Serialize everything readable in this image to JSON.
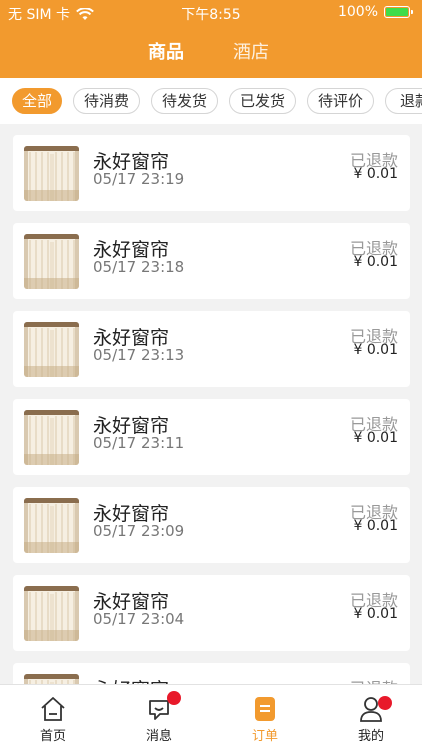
{
  "status_bar": {
    "carrier": "无 SIM 卡",
    "time": "下午8:55",
    "battery": "100%"
  },
  "top_tabs": [
    {
      "label": "商品",
      "active": true
    },
    {
      "label": "酒店",
      "active": false
    }
  ],
  "filters": [
    {
      "label": "全部",
      "active": true
    },
    {
      "label": "待消费",
      "active": false
    },
    {
      "label": "待发货",
      "active": false
    },
    {
      "label": "已发货",
      "active": false
    },
    {
      "label": "待评价",
      "active": false
    },
    {
      "label": "退款",
      "active": false
    }
  ],
  "orders": [
    {
      "title": "永好窗帘",
      "time": "05/17 23:19",
      "status": "已退款",
      "price": "¥ 0.01"
    },
    {
      "title": "永好窗帘",
      "time": "05/17 23:18",
      "status": "已退款",
      "price": "¥ 0.01"
    },
    {
      "title": "永好窗帘",
      "time": "05/17 23:13",
      "status": "已退款",
      "price": "¥ 0.01"
    },
    {
      "title": "永好窗帘",
      "time": "05/17 23:11",
      "status": "已退款",
      "price": "¥ 0.01"
    },
    {
      "title": "永好窗帘",
      "time": "05/17 23:09",
      "status": "已退款",
      "price": "¥ 0.01"
    },
    {
      "title": "永好窗帘",
      "time": "05/17 23:04",
      "status": "已退款",
      "price": "¥ 0.01"
    },
    {
      "title": "永好窗帘",
      "time": "",
      "status": "已退款",
      "price": ""
    }
  ],
  "tab_bar": [
    {
      "label": "首页",
      "icon": "home-icon",
      "active": false,
      "badge": false
    },
    {
      "label": "消息",
      "icon": "message-icon",
      "active": false,
      "badge": true
    },
    {
      "label": "订单",
      "icon": "order-icon",
      "active": true,
      "badge": false
    },
    {
      "label": "我的",
      "icon": "profile-icon",
      "active": false,
      "badge": true
    }
  ],
  "colors": {
    "accent": "#f29a2e",
    "badge": "#e8192a",
    "battery": "#3fdc4a"
  }
}
